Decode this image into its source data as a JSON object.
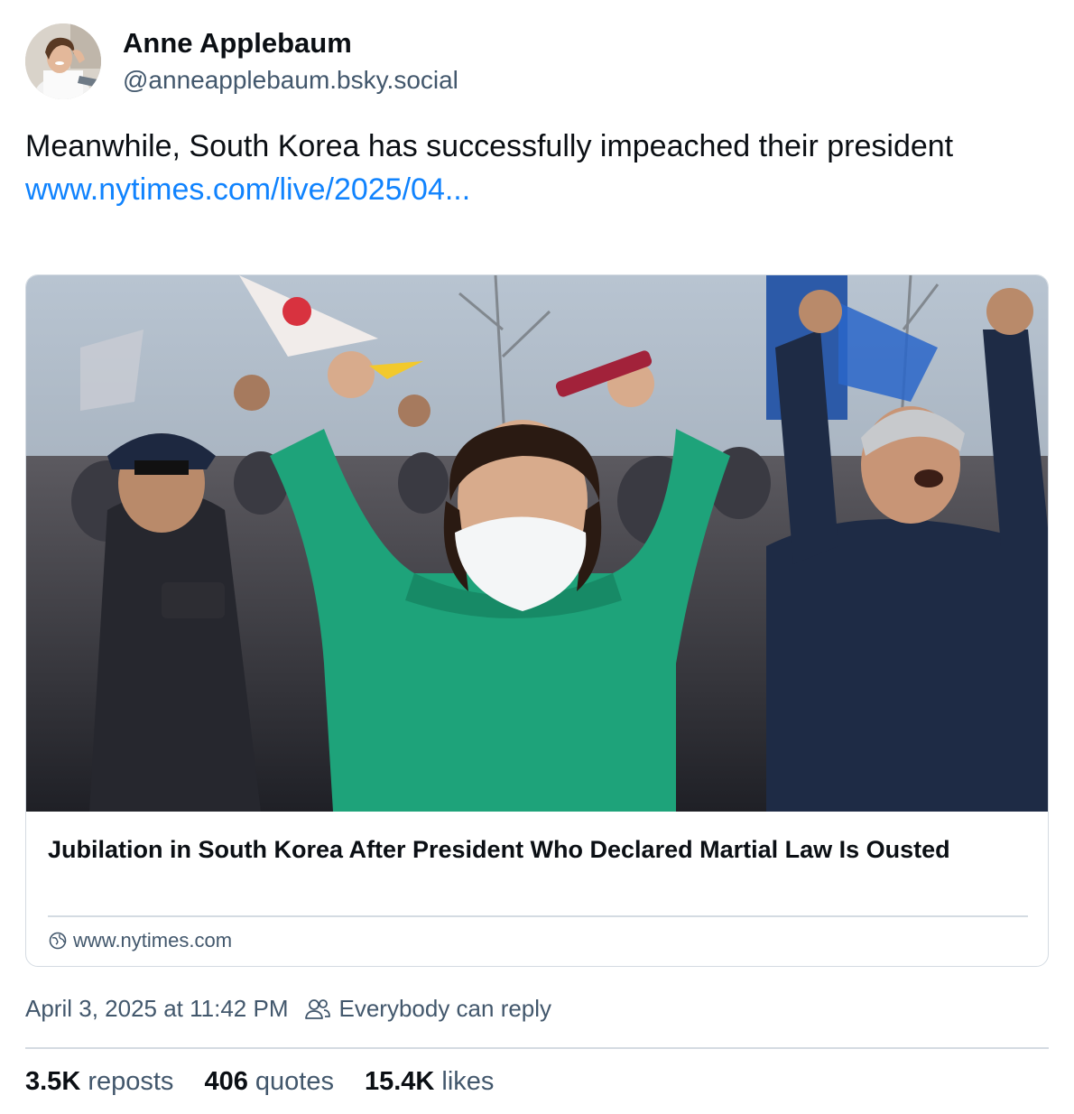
{
  "author": {
    "display_name": "Anne Applebaum",
    "handle": "@anneapplebaum.bsky.social"
  },
  "post": {
    "text": "Meanwhile, South Korea has successfully impeached their president",
    "link_text": "www.nytimes.com/live/2025/04..."
  },
  "embed": {
    "title": "Jubilation in South Korea After President Who Declared Martial Law Is Ousted",
    "domain": "www.nytimes.com",
    "domain_icon": "globe-icon",
    "image_icon": "celebrating-crowd-photo"
  },
  "meta": {
    "timestamp": "April 3, 2025 at 11:42 PM",
    "reply_icon": "people-icon",
    "reply_setting": "Everybody can reply"
  },
  "stats": [
    {
      "count": "3.5K",
      "label": "reposts"
    },
    {
      "count": "406",
      "label": "quotes"
    },
    {
      "count": "15.4K",
      "label": "likes"
    }
  ],
  "colors": {
    "link": "#1083fe",
    "secondary_text": "#42576c",
    "border": "#d4dbe2"
  }
}
